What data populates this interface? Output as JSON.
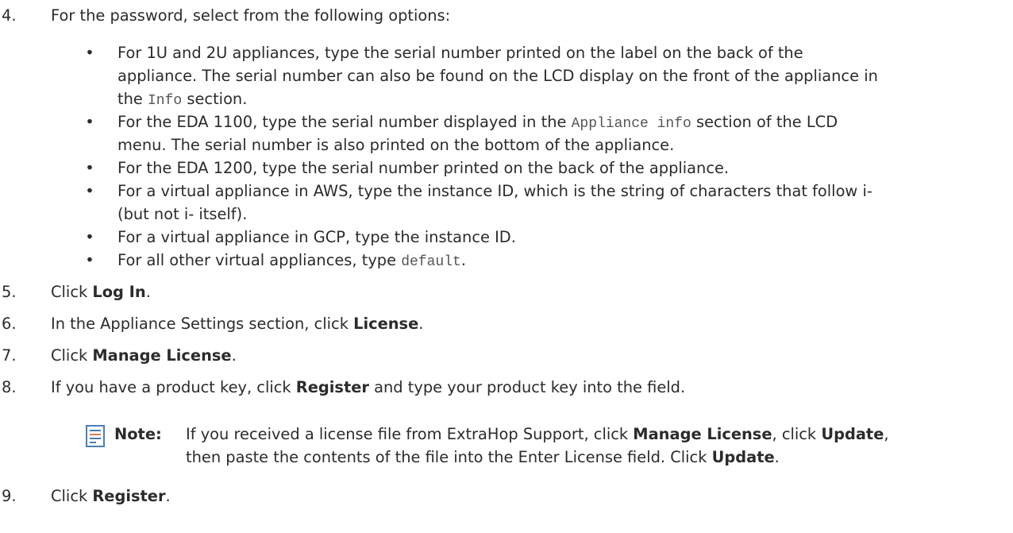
{
  "steps": [
    {
      "num": "4.",
      "text": "For the password, select from the following options:"
    },
    {
      "num": "5.",
      "pre": "Click ",
      "bold": "Log In",
      "post": "."
    },
    {
      "num": "6.",
      "pre": "In the Appliance Settings section, click ",
      "bold": "License",
      "post": "."
    },
    {
      "num": "7.",
      "pre": "Click ",
      "bold": "Manage License",
      "post": "."
    },
    {
      "num": "8.",
      "pre": "If you have a product key, click ",
      "bold": "Register",
      "post": " and type your product key into the field."
    },
    {
      "num": "9.",
      "pre": "Click ",
      "bold": "Register",
      "post": "."
    }
  ],
  "bullets": [
    {
      "l1": "For 1U and 2U appliances, type the serial number printed on the label on the back of the",
      "l2": "appliance. The serial number can also be found on the LCD display on the front of the appliance in",
      "l3_pre": "the ",
      "l3_code": "Info",
      "l3_post": " section."
    },
    {
      "l1_pre": "For the EDA 1100, type the serial number displayed in the ",
      "l1_code": "Appliance info",
      "l1_post": " section of the LCD",
      "l2": "menu. The serial number is also printed on the bottom of the appliance."
    },
    {
      "l1": "For the EDA 1200, type the serial number printed on the back of the appliance."
    },
    {
      "l1": "For a virtual appliance in AWS, type the instance ID, which is the string of characters that follow i-",
      "l2": "(but not i- itself)."
    },
    {
      "l1": "For a virtual appliance in GCP, type the instance ID."
    },
    {
      "l1_pre": "For all other virtual appliances, type ",
      "l1_code": "default",
      "l1_post": "."
    }
  ],
  "bullet_symbol": "•",
  "note": {
    "label": "Note:",
    "l1_pre": "If you received a license file from ExtraHop Support, click ",
    "l1_bold1": "Manage License",
    "l1_mid": ", click ",
    "l1_bold2": "Update",
    "l1_post": ",",
    "l2_pre": "then paste the contents of the file into the Enter License field. Click ",
    "l2_bold": "Update",
    "l2_post": "."
  },
  "colors": {
    "text": "#2b2b2b",
    "note_icon": "#4a7fb5"
  }
}
